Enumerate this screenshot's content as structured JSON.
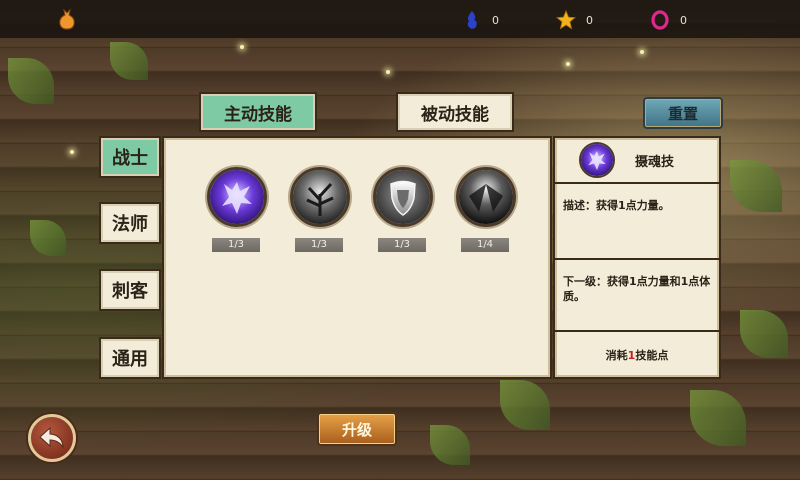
{
  "top_bar": {
    "icons": [
      "bag-icon",
      "blue-flame-icon",
      "gold-star-icon",
      "pink-ring-icon"
    ],
    "resources": [
      {
        "icon": "blue-flame-icon",
        "value": "0",
        "color": "#2c43c9"
      },
      {
        "icon": "gold-star-icon",
        "value": "0",
        "color": "#f2b21c"
      },
      {
        "icon": "pink-ring-icon",
        "value": "0",
        "color": "#e0288a"
      }
    ]
  },
  "tabs": {
    "active_label": "主动技能",
    "passive_label": "被动技能"
  },
  "reset_label": "重置",
  "classes": [
    "战士",
    "法师",
    "刺客",
    "通用"
  ],
  "selected_class": "战士",
  "skills": [
    {
      "icon": "purple-beast-skill-icon",
      "level": "1/3"
    },
    {
      "icon": "dark-tree-skill-icon",
      "level": "1/3"
    },
    {
      "icon": "silver-shield-skill-icon",
      "level": "1/3"
    },
    {
      "icon": "shadow-wings-skill-icon",
      "level": "1/4"
    }
  ],
  "detail": {
    "skill_name": "摄魂技",
    "icon": "purple-beast-skill-icon",
    "description": "描述：获得1点力量。",
    "next_level": "下一级：获得1点力量和1点体质。",
    "cost_prefix": "消耗",
    "cost_amount": "1",
    "cost_suffix": "技能点",
    "cost_highlight_color": "#c21f1f"
  },
  "upgrade_label": "升级",
  "back_icon": "back-arrow-icon",
  "colors": {
    "active_tab": "#7dcaa5",
    "panel_bg": "#f3ecd9",
    "upgrade_button": "#d88a3a",
    "reset_button": "#5a91a2"
  }
}
